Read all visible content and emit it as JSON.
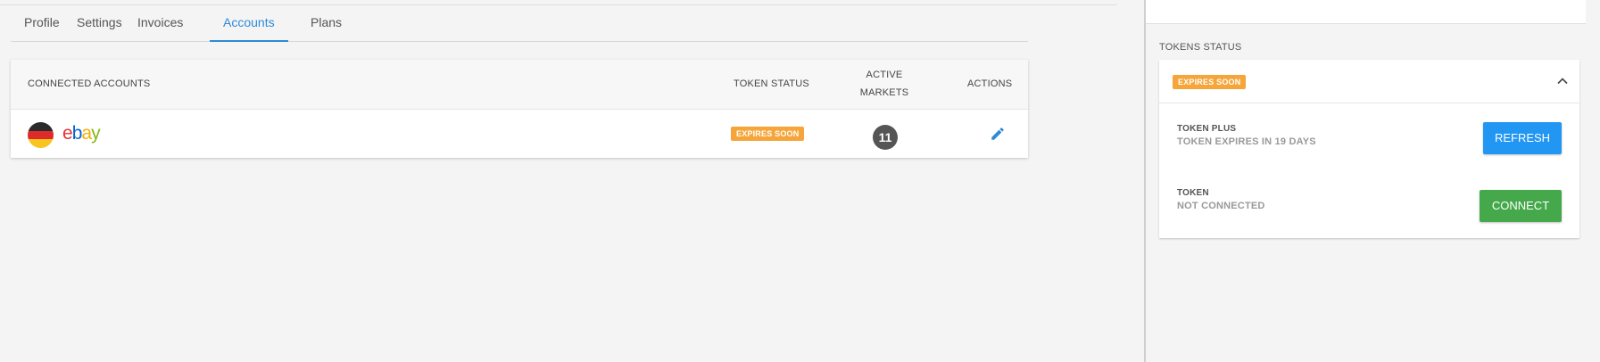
{
  "tabs": [
    {
      "label": "Profile"
    },
    {
      "label": "Settings"
    },
    {
      "label": "Invoices"
    },
    {
      "label": "Accounts"
    },
    {
      "label": "Plans"
    }
  ],
  "active_tab": "Accounts",
  "accounts_table": {
    "headers": {
      "connected_accounts": "CONNECTED ACCOUNTS",
      "token_status": "TOKEN STATUS",
      "active_markets_line1": "ACTIVE",
      "active_markets_line2": "MARKETS",
      "actions": "ACTIONS"
    },
    "rows": [
      {
        "flag": "germany-flag",
        "logo_text": "ebay",
        "token_status": "EXPIRES SOON",
        "active_markets": "11",
        "action_icon": "edit-icon"
      }
    ]
  },
  "tokens_panel": {
    "title": "TOKENS STATUS",
    "status_badge": "EXPIRES SOON",
    "items": [
      {
        "label": "TOKEN PLUS",
        "sub": "TOKEN EXPIRES IN 19 DAYS",
        "button": "REFRESH"
      },
      {
        "label": "TOKEN",
        "sub": "NOT CONNECTED",
        "button": "CONNECT"
      }
    ]
  },
  "colors": {
    "accent": "#2d8ad6",
    "badge": "#f5a53a",
    "refresh": "#2196f3",
    "connect": "#45a94c"
  }
}
